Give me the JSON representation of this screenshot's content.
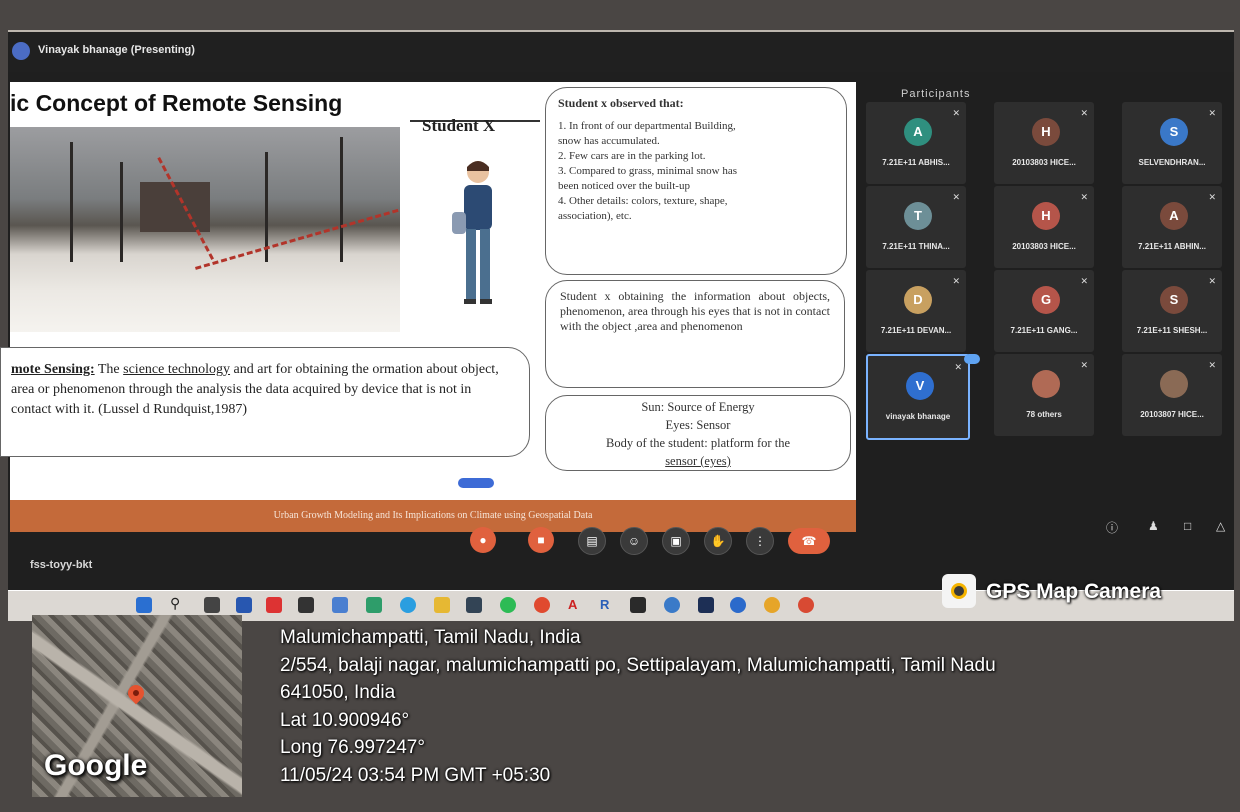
{
  "meeting": {
    "presenter_label": "Vinayak bhanage (Presenting)",
    "people_panel_title": "Participants",
    "meeting_code": "fss-toyy-bkt"
  },
  "slide": {
    "title": "ic Concept of Remote Sensing",
    "student_label": "Student X",
    "observations_heading": "Student x observed that:",
    "observations": [
      "1. In front of our departmental Building,",
      "snow has accumulated.",
      "2. Few cars are in the parking lot.",
      "3. Compared to grass, minimal snow has",
      "been noticed over the built-up",
      "4. Other details: colors, texture, shape,",
      "association), etc."
    ],
    "obtaining_text": "Student x obtaining the information about objects, phenomenon, area through his eyes that is not in contact with the object ,area and phenomenon",
    "sun_lines": [
      "Sun: Source of Energy",
      "Eyes: Sensor",
      "Body of the student: platform for the",
      "sensor (eyes)"
    ],
    "definition_keyword": "mote Sensing:",
    "definition_text_1": " The ",
    "definition_underlined": "science technology",
    "definition_text_2": " and art for obtaining the ormation about object, area or phenomenon through the analysis the data acquired by device that is  not in contact with it. (Lussel d Rundquist,1987)",
    "footer": "Urban Growth Modeling and Its Implications on Climate using Geospatial Data"
  },
  "participants": [
    {
      "name": "7.21E+11 ABHIS...",
      "initial": "A",
      "color": "#2f8f7f"
    },
    {
      "name": "20103803 HICE...",
      "initial": "H",
      "color": "#7a4a3c"
    },
    {
      "name": "SELVENDHRAN...",
      "initial": "S",
      "color": "#3a78c8"
    },
    {
      "name": "7.21E+11 THINA...",
      "initial": "T",
      "color": "#6d8f97"
    },
    {
      "name": "20103803 HICE...",
      "initial": "H",
      "color": "#b5554a"
    },
    {
      "name": "7.21E+11 ABHIN...",
      "initial": "A",
      "color": "#7a4a3c"
    },
    {
      "name": "7.21E+11 DEVAN...",
      "initial": "D",
      "color": "#c8a060"
    },
    {
      "name": "7.21E+11 GANG...",
      "initial": "G",
      "color": "#b5554a"
    },
    {
      "name": "7.21E+11 SHESH...",
      "initial": "S",
      "color": "#7a4a3c"
    },
    {
      "name": "vinayak bhanage",
      "initial": "V",
      "color": "#2f6fd0"
    },
    {
      "name": "78 others",
      "initial": "",
      "color": "#b06a55"
    },
    {
      "name": "20103807 HICE...",
      "initial": "",
      "color": "#8a6a55"
    }
  ],
  "gps": {
    "brand": "GPS Map Camera",
    "map_label": "Google",
    "place": "Malumichampatti, Tamil Nadu, India",
    "address_1": "2/554, balaji nagar, malumichampatti po, Settipalayam, Malumichampatti, Tamil Nadu",
    "address_2": "641050, India",
    "lat": "Lat 10.900946°",
    "long": "Long 76.997247°",
    "datetime": "11/05/24 03:54 PM GMT +05:30"
  },
  "icons": [
    "start-icon",
    "search-icon",
    "taskview-icon",
    "explorer-icon",
    "chrome-icon",
    "edge-icon",
    "whatsapp-icon",
    "acrobat-icon",
    "camera-icon"
  ]
}
